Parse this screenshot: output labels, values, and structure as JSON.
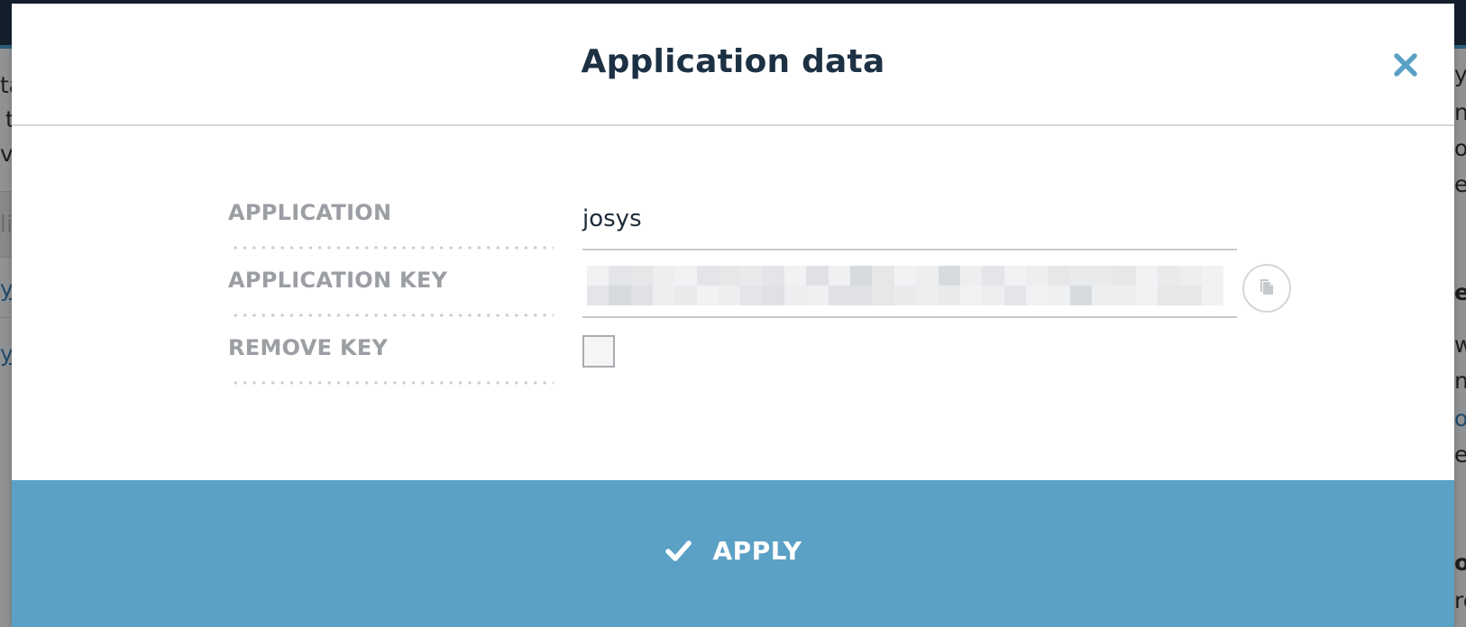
{
  "background": {
    "fragments_left": [
      "ta",
      "t",
      "v",
      "li",
      "ys",
      "ys"
    ],
    "fragments_right": [
      "ys",
      "nt",
      "ou",
      "e",
      "e",
      "w",
      "nt",
      "o",
      "e",
      "o",
      "re"
    ]
  },
  "modal": {
    "title": "Application data",
    "close_icon": "close-icon",
    "fields": {
      "application": {
        "label": "APPLICATION",
        "value": "josys"
      },
      "application_key": {
        "label": "APPLICATION KEY",
        "value_redacted": true
      },
      "remove_key": {
        "label": "REMOVE KEY",
        "checked": false
      }
    },
    "copy_icon": "copy-icon",
    "apply": {
      "label": "APPLY",
      "icon": "check-icon"
    }
  },
  "colors": {
    "title": "#1d3144",
    "close": "#5ba1c6",
    "label": "#9b9ea3",
    "apply_bg": "#5ba1c6",
    "apply_text": "#ffffff"
  }
}
